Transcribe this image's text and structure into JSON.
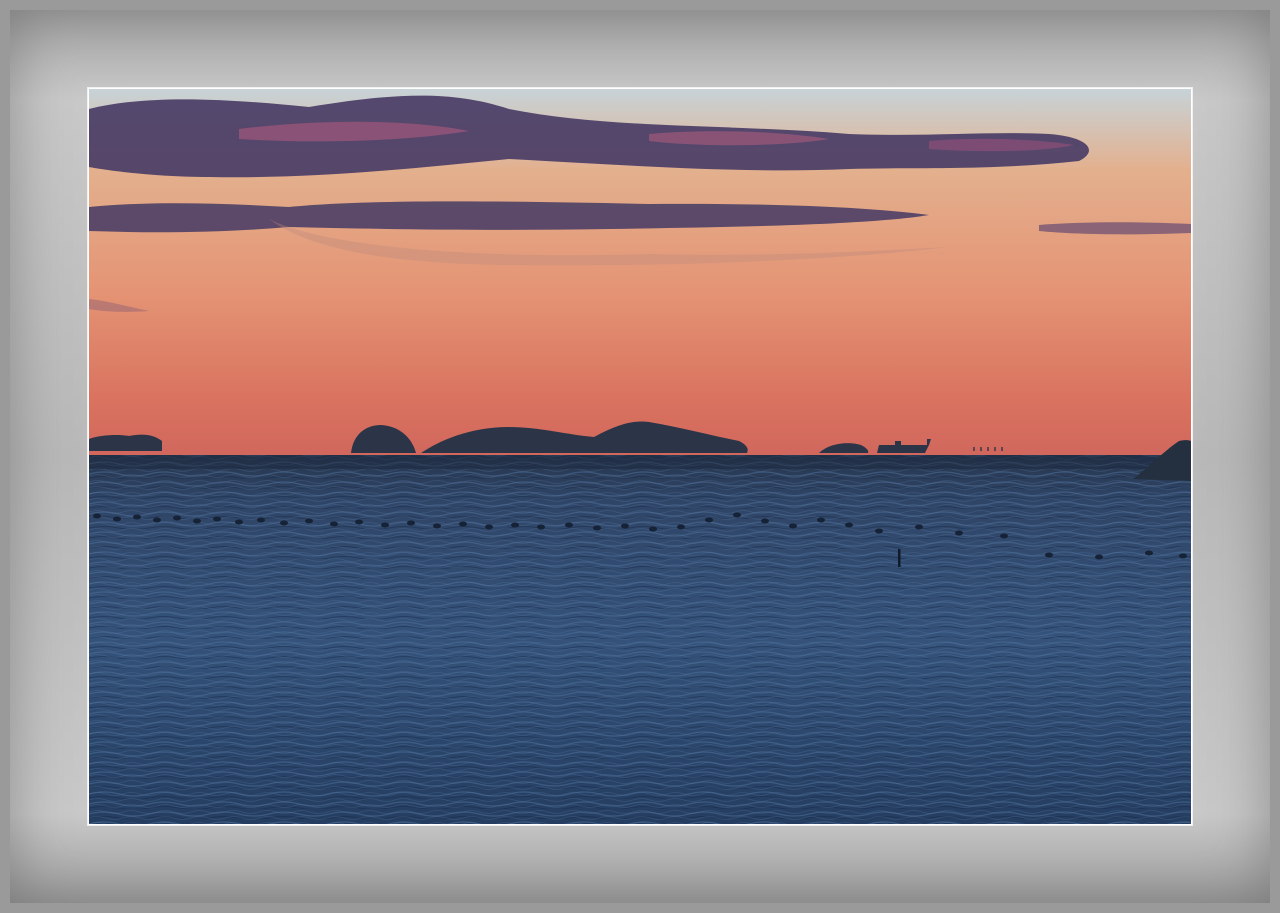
{
  "colors": {
    "sky_top": "#c9d6dc",
    "sky_mid": "#e8a67e",
    "sky_low": "#d9735f",
    "horizon_glow": "#d8685e",
    "cloud": "#4a3f66",
    "cloud_highlight": "#a85a7a",
    "silhouette": "#2b3446",
    "sea_top": "#2d3f5c",
    "sea_mid": "#2f4a6e",
    "sea_bottom": "#1f3553",
    "frame": "#b4b4b4"
  }
}
